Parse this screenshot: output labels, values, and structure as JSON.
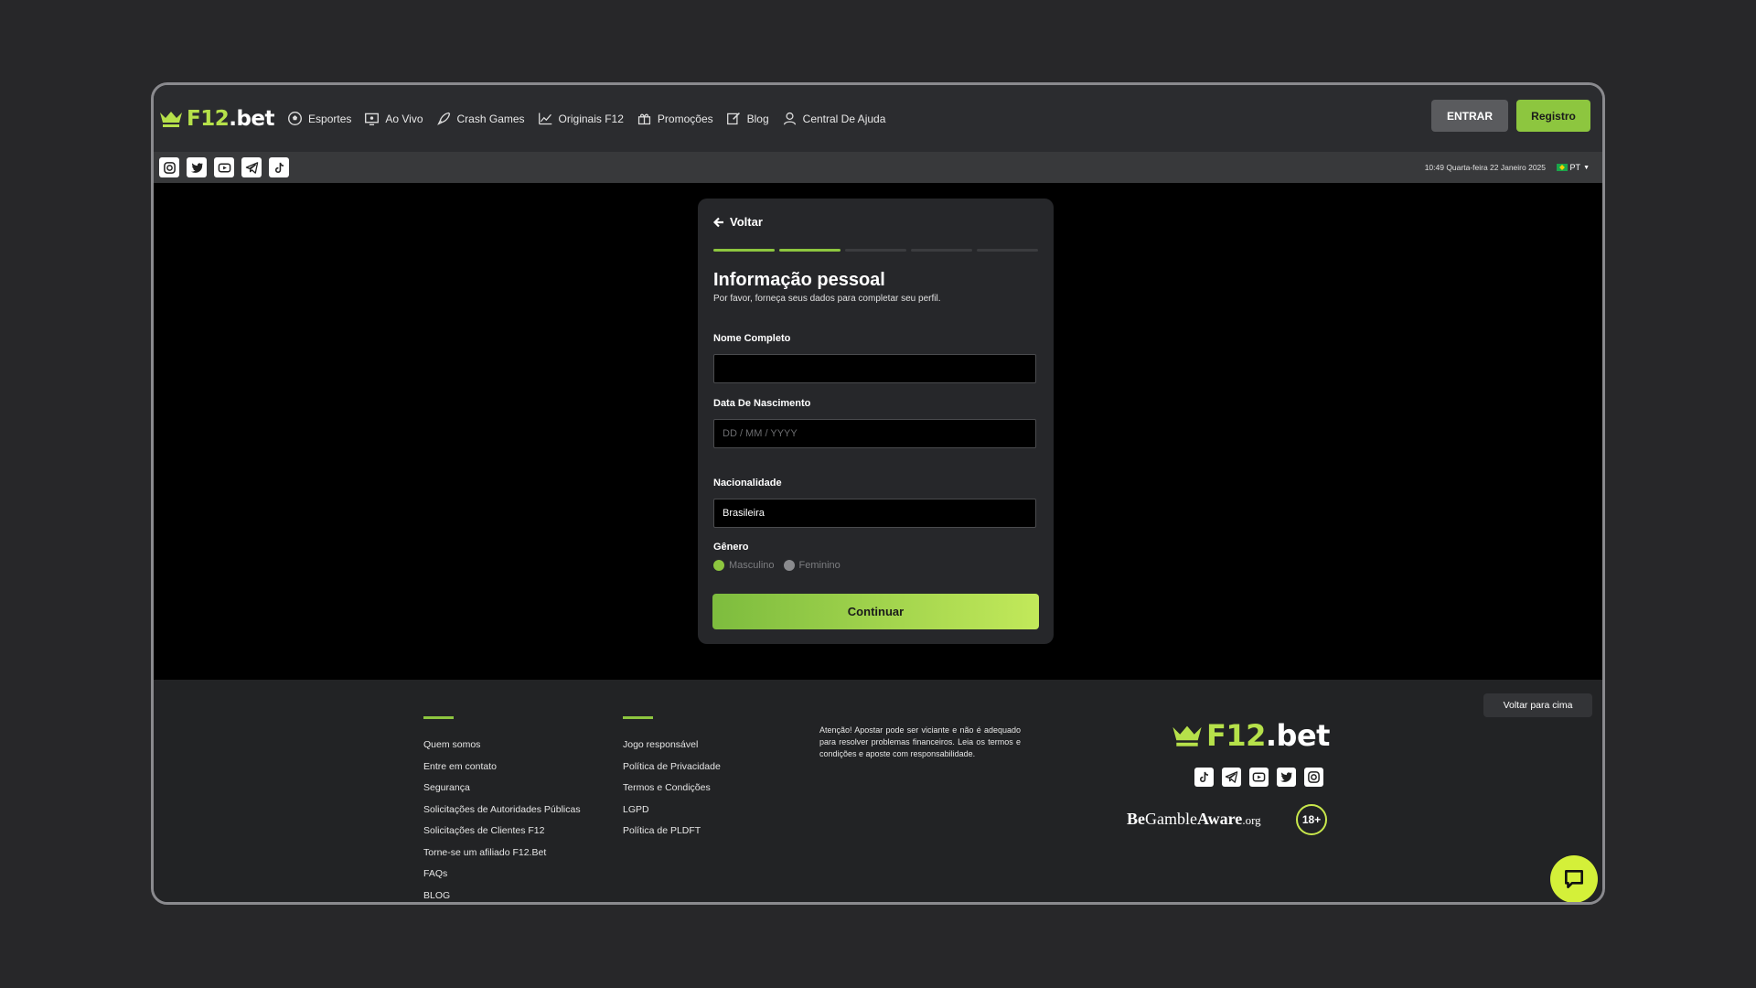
{
  "brand": {
    "logo_main": "F12",
    "logo_suffix": ".bet"
  },
  "nav": [
    {
      "label": "Esportes",
      "icon": "soccer-ball-icon"
    },
    {
      "label": "Ao Vivo",
      "icon": "live-tv-icon"
    },
    {
      "label": "Crash Games",
      "icon": "rocket-icon"
    },
    {
      "label": "Originais F12",
      "icon": "chart-icon"
    },
    {
      "label": "Promoções",
      "icon": "gift-icon"
    },
    {
      "label": "Blog",
      "icon": "edit-icon"
    },
    {
      "label": "Central De Ajuda",
      "icon": "support-agent-icon"
    }
  ],
  "auth": {
    "login_label": "ENTRAR",
    "register_label": "Registro"
  },
  "subbar": {
    "datetime": "10:49 Quarta-feira 22 Janeiro 2025",
    "language": "PT"
  },
  "form": {
    "back_label": "Voltar",
    "steps_total": 5,
    "steps_completed": 2,
    "title": "Informação pessoal",
    "subtitle": "Por favor, forneça seus dados para completar seu perfil.",
    "full_name_label": "Nome Completo",
    "full_name_value": "",
    "birth_label": "Data De Nascimento",
    "birth_placeholder": "DD / MM / YYYY",
    "nationality_label": "Nacionalidade",
    "nationality_value": "Brasileira",
    "gender_label": "Gênero",
    "gender_options": [
      "Masculino",
      "Feminino"
    ],
    "gender_selected": "Masculino",
    "submit_label": "Continuar"
  },
  "footer": {
    "col1": [
      "Quem somos",
      "Entre em contato",
      "Segurança",
      "Solicitações de Autoridades Públicas",
      "Solicitações de Clientes F12",
      "Torne-se um afiliado F12.Bet",
      "FAQs",
      "BLOG"
    ],
    "col2": [
      "Jogo responsável",
      "Política de Privacidade",
      "Termos e Condições",
      "LGPD",
      "Política de PLDFT"
    ],
    "warning": "Atenção! Apostar pode ser viciante e não é adequado para resolver problemas financeiros. Leia os termos e condições e aposte com responsabilidade.",
    "back_to_top": "Voltar para cima",
    "gamble_be": "Be",
    "gamble_gamble": "Gamble",
    "gamble_aware": "Aware",
    "gamble_org": ".org",
    "age_badge": "18+"
  },
  "colors": {
    "accent": "#8dc63f",
    "accent_light": "#c2e95a",
    "bg": "#222325"
  }
}
